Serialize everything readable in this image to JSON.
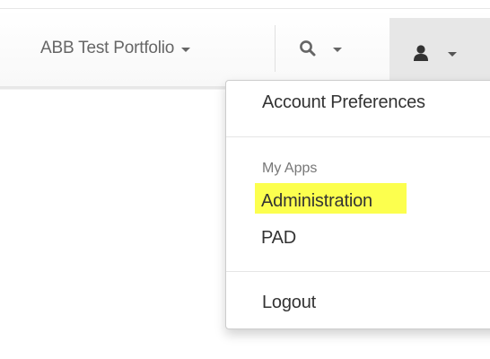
{
  "navbar": {
    "portfolio_label": "ABB Test Portfolio",
    "search_icon": "search-icon",
    "user_icon": "user-icon",
    "dropdown_icon": "caret-down-icon"
  },
  "dropdown": {
    "account_preferences": "Account Preferences",
    "my_apps_header": "My Apps",
    "apps": [
      "Administration",
      "PAD"
    ],
    "logout": "Logout"
  },
  "highlight": {
    "target": "Administration",
    "color": "#fcff3b"
  },
  "colors": {
    "nav_text": "#666666",
    "menu_text": "#333333",
    "header_text": "#777777",
    "user_button_bg": "#e7e7e7"
  }
}
